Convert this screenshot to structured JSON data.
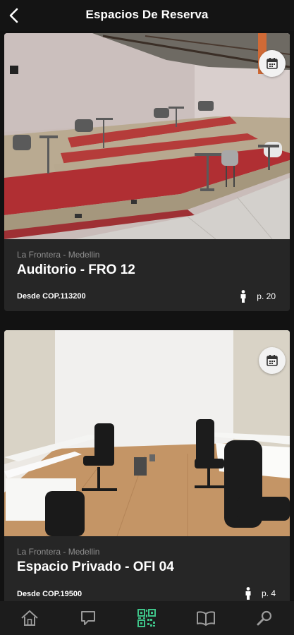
{
  "header": {
    "title": "Espacios De Reserva",
    "back_icon": "chevron-left-icon"
  },
  "spaces": [
    {
      "location": "La Frontera - Medellin",
      "name": "Auditorio - FRO 12",
      "price": "Desde COP.113200",
      "capacity": "p. 20",
      "calendar_icon": "calendar-icon",
      "person_icon": "person-icon"
    },
    {
      "location": "La Frontera - Medellin",
      "name": "Espacio Privado - OFI 04",
      "price": "Desde COP.19500",
      "capacity": "p. 4",
      "calendar_icon": "calendar-icon",
      "person_icon": "person-icon"
    }
  ],
  "bottom_nav": {
    "items": [
      "home-icon",
      "chat-icon",
      "qr-code-icon",
      "book-icon",
      "search-icon"
    ],
    "active": "qr-code-icon"
  },
  "colors": {
    "background": "#121212",
    "card": "#262626",
    "accent_green": "#3ec489",
    "muted_text": "#8f8f8f"
  }
}
